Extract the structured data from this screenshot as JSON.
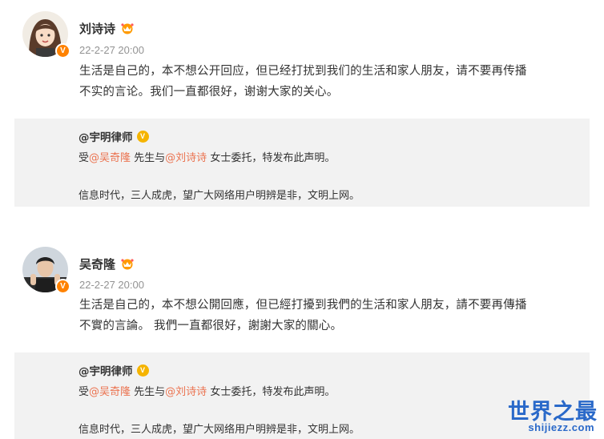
{
  "posts": [
    {
      "author": "刘诗诗",
      "time": "22-2-27 20:00",
      "text_line1": "生活是自己的，本不想公开回应，但已经打扰到我们的生活和家人朋友，请不要再传播",
      "text_line2": "不实的言论。我们一直都很好，谢谢大家的关心。",
      "repost": {
        "author": "@宇明律师",
        "line1_prefix": "受",
        "mention1": "@吴奇隆",
        "line1_mid": " 先生与",
        "mention2": "@刘诗诗",
        "line1_suffix": " 女士委托，特发布此声明。",
        "line2": "信息时代，三人成虎，望广大网络用户明辨是非，文明上网。"
      }
    },
    {
      "author": "吴奇隆",
      "time": "22-2-27 20:00",
      "text_line1": "生活是自己的，本不想公開回應，但已經打擾到我們的生活和家人朋友，請不要再傳播",
      "text_line2": "不實的言論。 我們一直都很好，謝謝大家的關心。",
      "repost": {
        "author": "@宇明律师",
        "line1_prefix": "受",
        "mention1": "@吴奇隆",
        "line1_mid": " 先生与",
        "mention2": "@刘诗诗",
        "line1_suffix": " 女士委托，特发布此声明。",
        "line2": "信息时代，三人成虎，望广大网络用户明辨是非，文明上网。"
      }
    }
  ],
  "watermark": {
    "main": "世界之最",
    "sub": "shijiezz.com"
  },
  "colors": {
    "mention": "#eb7350",
    "verified_badge": "#ff8200",
    "repost_bg": "#f2f2f2",
    "watermark": "#2a69c9"
  }
}
